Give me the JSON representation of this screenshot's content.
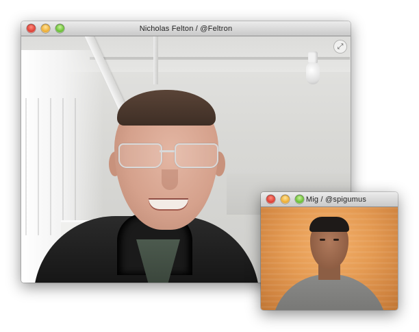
{
  "main_window": {
    "title": "Nicholas Felton / @Feltron",
    "controls": {
      "close": "close-button",
      "minimize": "minimize-button",
      "zoom": "zoom-button"
    },
    "fullscreen_icon": "expand-arrows-icon",
    "fullscreen_glyph": "⤢"
  },
  "small_window": {
    "title": "Mig / @spigumus",
    "controls": {
      "close": "close-button",
      "minimize": "minimize-button",
      "zoom": "zoom-button"
    }
  },
  "colors": {
    "close": "#e0443a",
    "minimize": "#f0b23a",
    "zoom": "#6fc33b",
    "small_video_background": "#e49a52"
  }
}
